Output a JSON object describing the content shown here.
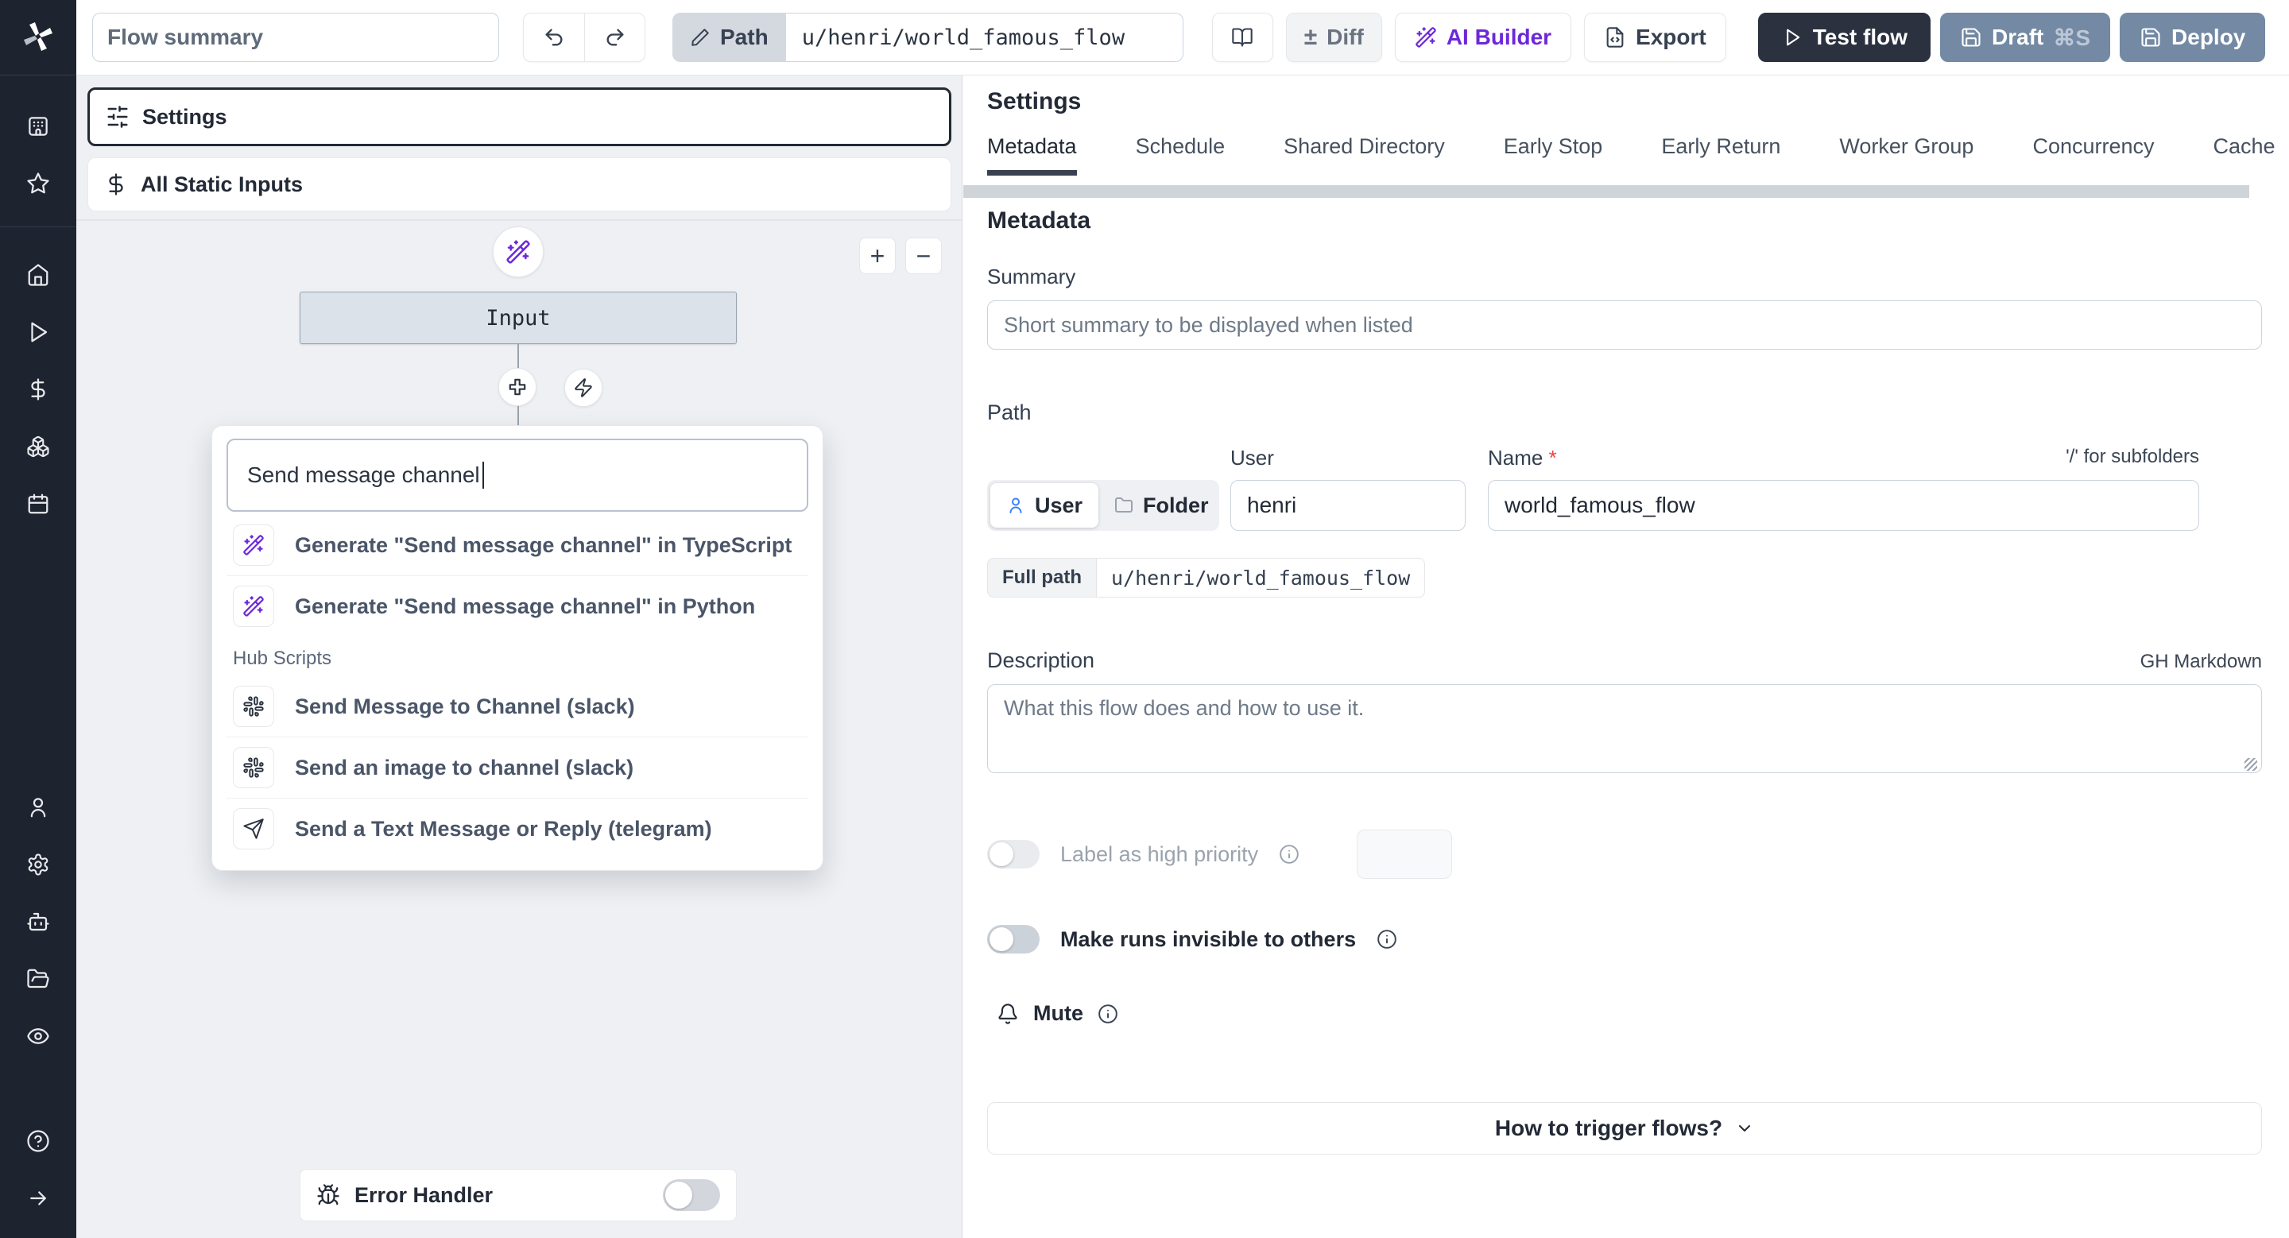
{
  "toolbar": {
    "flow_summary_placeholder": "Flow summary",
    "path_label": "Path",
    "path_value": "u/henri/world_famous_flow",
    "diff_label": "Diff",
    "diff_symbol": "±",
    "ai_builder_label": "AI Builder",
    "export_label": "Export",
    "test_flow_label": "Test flow",
    "draft_label": "Draft",
    "draft_shortcut": "⌘S",
    "deploy_label": "Deploy",
    "colors": {
      "dark_button": "#2b313e",
      "slate_button": "#7389a4",
      "accent_purple": "#6d28d9"
    }
  },
  "sidebar": {
    "icons": [
      "windmill-logo",
      "workspace",
      "favorites",
      "home",
      "runs",
      "variables",
      "resources",
      "schedules",
      "users",
      "settings",
      "workers",
      "folders",
      "audit-logs",
      "help",
      "expand"
    ]
  },
  "flow_panel": {
    "settings_label": "Settings",
    "all_static_inputs_label": "All Static Inputs",
    "input_node_label": "Input",
    "zoom_in_label": "+",
    "zoom_out_label": "−",
    "search_value": "Send message channel",
    "dropdown": {
      "generate_items": [
        {
          "icon": "wand-sparkles",
          "label": "Generate \"Send message channel\" in TypeScript"
        },
        {
          "icon": "wand-sparkles",
          "label": "Generate \"Send message channel\" in Python"
        }
      ],
      "section_label": "Hub Scripts",
      "hub_items": [
        {
          "icon": "slack",
          "label": "Send Message to Channel (slack)"
        },
        {
          "icon": "slack",
          "label": "Send an image to channel (slack)"
        },
        {
          "icon": "telegram-send",
          "label": "Send a Text Message or Reply (telegram)"
        }
      ]
    },
    "error_handler_label": "Error Handler"
  },
  "settings_panel": {
    "title": "Settings",
    "tabs": [
      "Metadata",
      "Schedule",
      "Shared Directory",
      "Early Stop",
      "Early Return",
      "Worker Group",
      "Concurrency",
      "Cache"
    ],
    "active_tab": "Metadata",
    "metadata": {
      "heading": "Metadata",
      "summary_label": "Summary",
      "summary_placeholder": "Short summary to be displayed when listed",
      "path_label": "Path",
      "owner_kind_user": "User",
      "owner_kind_folder": "Folder",
      "owner_selected": "User",
      "user_label": "User",
      "user_value": "henri",
      "name_label": "Name",
      "required_mark": "*",
      "subfolder_hint": "'/' for subfolders",
      "name_value": "world_famous_flow",
      "full_path_label": "Full path",
      "full_path_value": "u/henri/world_famous_flow",
      "description_label": "Description",
      "markdown_hint": "GH Markdown",
      "description_placeholder": "What this flow does and how to use it.",
      "high_priority_label": "Label as high priority",
      "invisible_runs_label": "Make runs invisible to others",
      "mute_label": "Mute",
      "trigger_button_label": "How to trigger flows?"
    }
  }
}
